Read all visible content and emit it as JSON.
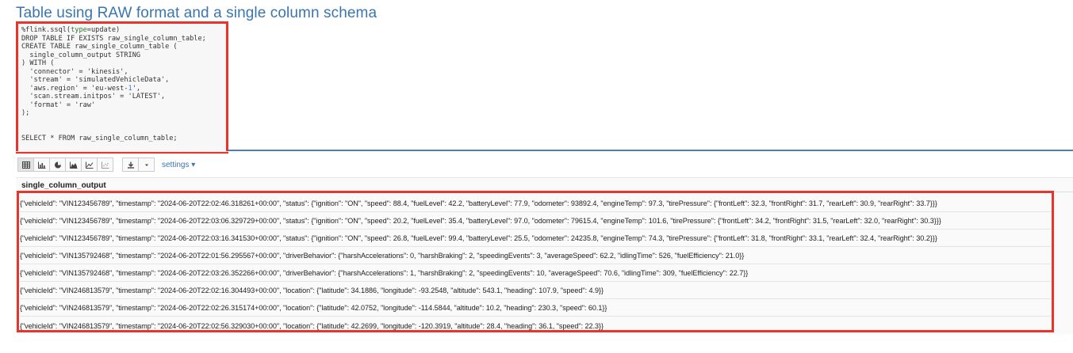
{
  "page": {
    "title": "Table using RAW format and a single column schema"
  },
  "editor": {
    "lines": [
      [
        {
          "t": "%flink.ssql("
        },
        {
          "t": "type",
          "c": "kw"
        },
        {
          "t": "=update)"
        }
      ],
      [
        {
          "t": "DROP TABLE IF EXISTS raw_single_column_table;"
        }
      ],
      [
        {
          "t": "CREATE TABLE raw_single_column_table ("
        }
      ],
      [
        {
          "t": "  single_column_output STRING"
        }
      ],
      [
        {
          "t": ") WITH ("
        }
      ],
      [
        {
          "t": "  'connector' = 'kinesis',"
        }
      ],
      [
        {
          "t": "  'stream' = 'simulatedVehicleData',"
        }
      ],
      [
        {
          "t": "  'aws.region' = 'eu-west-"
        },
        {
          "t": "1",
          "c": "num"
        },
        {
          "t": "',"
        }
      ],
      [
        {
          "t": "  'scan.stream.initpos' = 'LATEST',"
        }
      ],
      [
        {
          "t": "  'format' = 'raw'"
        }
      ],
      [
        {
          "t": ");"
        }
      ],
      [
        {
          "t": ""
        }
      ],
      [
        {
          "t": ""
        }
      ],
      [
        {
          "t": "SELECT * FROM raw_single_column_table;"
        }
      ]
    ]
  },
  "toolbar": {
    "buttons": [
      {
        "name": "table-view-button",
        "icon": "table-icon"
      },
      {
        "name": "bar-chart-button",
        "icon": "bar-chart-icon"
      },
      {
        "name": "pie-chart-button",
        "icon": "pie-chart-icon"
      },
      {
        "name": "area-chart-button",
        "icon": "area-chart-icon"
      },
      {
        "name": "line-chart-button",
        "icon": "line-chart-icon"
      },
      {
        "name": "scatter-chart-button",
        "icon": "scatter-chart-icon"
      }
    ],
    "download_icon": "download-icon",
    "dropdown_icon": "caret-down-icon",
    "settings_label": "settings ▾"
  },
  "results": {
    "column_header": "single_column_output",
    "rows": [
      "{\"vehicleId\": \"VIN123456789\", \"timestamp\": \"2024-06-20T22:02:46.318261+00:00\", \"status\": {\"ignition\": \"ON\", \"speed\": 88.4, \"fuelLevel\": 42.2, \"batteryLevel\": 77.9, \"odometer\": 93892.4, \"engineTemp\": 97.3, \"tirePressure\": {\"frontLeft\": 32.3, \"frontRight\": 31.7, \"rearLeft\": 30.9, \"rearRight\": 33.7}}}",
      "{\"vehicleId\": \"VIN123456789\", \"timestamp\": \"2024-06-20T22:03:06.329729+00:00\", \"status\": {\"ignition\": \"ON\", \"speed\": 20.2, \"fuelLevel\": 35.4, \"batteryLevel\": 97.0, \"odometer\": 79615.4, \"engineTemp\": 101.6, \"tirePressure\": {\"frontLeft\": 34.2, \"frontRight\": 31.5, \"rearLeft\": 32.0, \"rearRight\": 30.3}}}",
      "{\"vehicleId\": \"VIN123456789\", \"timestamp\": \"2024-06-20T22:03:16.341530+00:00\", \"status\": {\"ignition\": \"ON\", \"speed\": 26.8, \"fuelLevel\": 99.4, \"batteryLevel\": 25.5, \"odometer\": 24235.8, \"engineTemp\": 74.3, \"tirePressure\": {\"frontLeft\": 31.8, \"frontRight\": 33.1, \"rearLeft\": 32.4, \"rearRight\": 30.2}}}",
      "{\"vehicleId\": \"VIN135792468\", \"timestamp\": \"2024-06-20T22:01:56.295567+00:00\", \"driverBehavior\": {\"harshAccelerations\": 0, \"harshBraking\": 2, \"speedingEvents\": 3, \"averageSpeed\": 62.2, \"idlingTime\": 526, \"fuelEfficiency\": 21.0}}",
      "{\"vehicleId\": \"VIN135792468\", \"timestamp\": \"2024-06-20T22:03:26.352266+00:00\", \"driverBehavior\": {\"harshAccelerations\": 1, \"harshBraking\": 2, \"speedingEvents\": 10, \"averageSpeed\": 70.6, \"idlingTime\": 309, \"fuelEfficiency\": 22.7}}",
      "{\"vehicleId\": \"VIN246813579\", \"timestamp\": \"2024-06-20T22:02:16.304493+00:00\", \"location\": {\"latitude\": 34.1886, \"longitude\": -93.2548, \"altitude\": 543.1, \"heading\": 107.9, \"speed\": 4.9}}",
      "{\"vehicleId\": \"VIN246813579\", \"timestamp\": \"2024-06-20T22:02:26.315174+00:00\", \"location\": {\"latitude\": 42.0752, \"longitude\": -114.5844, \"altitude\": 10.2, \"heading\": 230.3, \"speed\": 60.1}}",
      "{\"vehicleId\": \"VIN246813579\", \"timestamp\": \"2024-06-20T22:02:56.329030+00:00\", \"location\": {\"latitude\": 42.2699, \"longitude\": -120.3919, \"altitude\": 28.4, \"heading\": 36.1, \"speed\": 22.3}}"
    ]
  },
  "colors": {
    "title": "#3a75b0",
    "highlight_border": "#e8352c",
    "divider": "#4a7fc0",
    "link": "#3a75b0"
  }
}
